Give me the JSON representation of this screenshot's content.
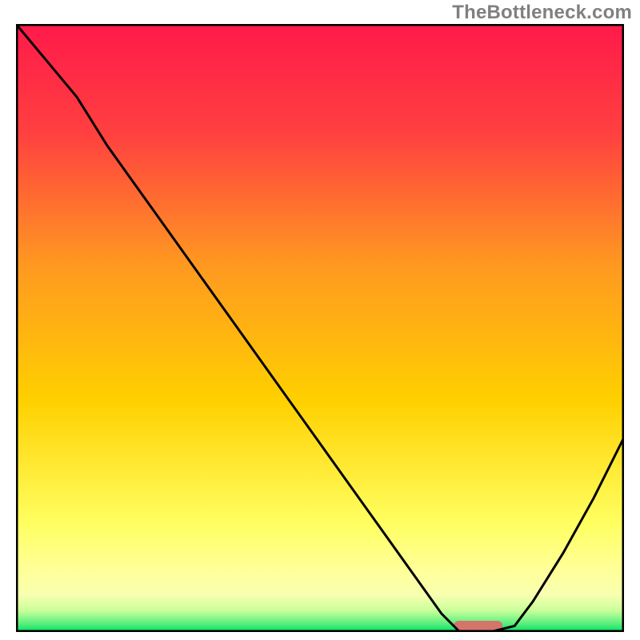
{
  "watermark": "TheBottleneck.com",
  "chart_data": {
    "type": "line",
    "title": "",
    "xlabel": "",
    "ylabel": "",
    "xlim": [
      0,
      100
    ],
    "ylim": [
      0,
      100
    ],
    "grid": false,
    "legend": false,
    "background_gradient": {
      "top_color": "#ff1a4a",
      "mid_color": "#ffd000",
      "lower_band_color": "#ffff8a",
      "bottom_color": "#00e060"
    },
    "series": [
      {
        "name": "bottleneck-curve",
        "x": [
          0,
          5,
          10,
          15,
          20,
          25,
          30,
          35,
          40,
          45,
          50,
          55,
          60,
          65,
          70,
          73,
          78,
          82,
          85,
          90,
          95,
          100
        ],
        "y": [
          100,
          94,
          88,
          80,
          73,
          66,
          59,
          52,
          45,
          38,
          31,
          24,
          17,
          10,
          3,
          0,
          0,
          1,
          5,
          13,
          22,
          32
        ]
      }
    ],
    "annotations": [
      {
        "name": "optimal-marker",
        "type": "bar",
        "x_start": 72,
        "x_end": 80,
        "y": 0,
        "color": "#d4756b"
      }
    ]
  }
}
